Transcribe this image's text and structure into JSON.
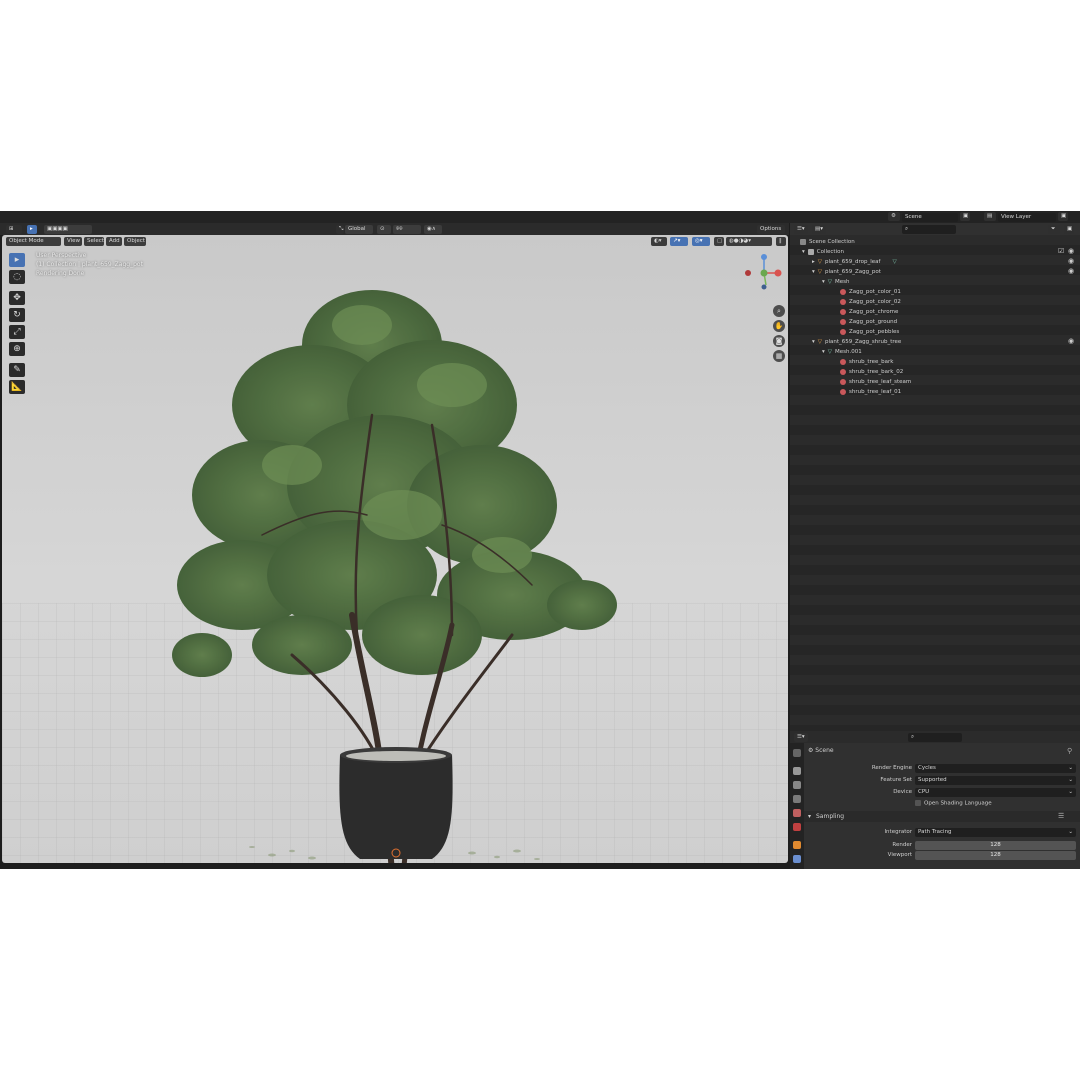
{
  "header": {
    "scene_label": "Scene",
    "view_layer_label": "View Layer"
  },
  "viewport": {
    "mode_label": "Object Mode",
    "menus": [
      "View",
      "Select",
      "Add",
      "Object"
    ],
    "orientation": "Global",
    "options_label": "Options",
    "overlay_lines": [
      "User Perspective",
      "(1) Collection | plant_659_Zagg_pot",
      "Rendering Done"
    ],
    "axes": {
      "x": "X",
      "y": "Y",
      "z": "Z"
    }
  },
  "outliner": {
    "search_placeholder": "",
    "rows": [
      {
        "label": "Scene Collection",
        "kind": "collection"
      },
      {
        "label": "Collection",
        "kind": "collection"
      },
      {
        "label": "plant_659_drop_leaf",
        "kind": "object"
      },
      {
        "label": "plant_659_Zagg_pot",
        "kind": "object"
      },
      {
        "label": "Mesh",
        "kind": "mesh"
      },
      {
        "label": "Zagg_pot_color_01",
        "kind": "material"
      },
      {
        "label": "Zagg_pot_color_02",
        "kind": "material"
      },
      {
        "label": "Zagg_pot_chrome",
        "kind": "material"
      },
      {
        "label": "Zagg_pot_ground",
        "kind": "material"
      },
      {
        "label": "Zagg_pot_pebbles",
        "kind": "material"
      },
      {
        "label": "plant_659_Zagg_shrub_tree",
        "kind": "object"
      },
      {
        "label": "Mesh.001",
        "kind": "mesh"
      },
      {
        "label": "shrub_tree_bark",
        "kind": "material"
      },
      {
        "label": "shrub_tree_bark_02",
        "kind": "material"
      },
      {
        "label": "shrub_tree_leaf_steam",
        "kind": "material"
      },
      {
        "label": "shrub_tree_leaf_01",
        "kind": "material"
      }
    ]
  },
  "properties": {
    "context_label": "Scene",
    "render_engine_label": "Render Engine",
    "render_engine_value": "Cycles",
    "feature_set_label": "Feature Set",
    "feature_set_value": "Supported",
    "device_label": "Device",
    "device_value": "CPU",
    "osl_label": "Open Shading Language",
    "sampling_label": "Sampling",
    "integrator_label": "Integrator",
    "integrator_value": "Path Tracing",
    "render_samples_label": "Render",
    "render_samples_value": "128",
    "viewport_samples_label": "Viewport",
    "viewport_samples_value": "128"
  },
  "colors": {
    "accent": "#4772b3",
    "material": "#c9585b",
    "object": "#e8a24a",
    "mesh": "#7ec9b0"
  }
}
